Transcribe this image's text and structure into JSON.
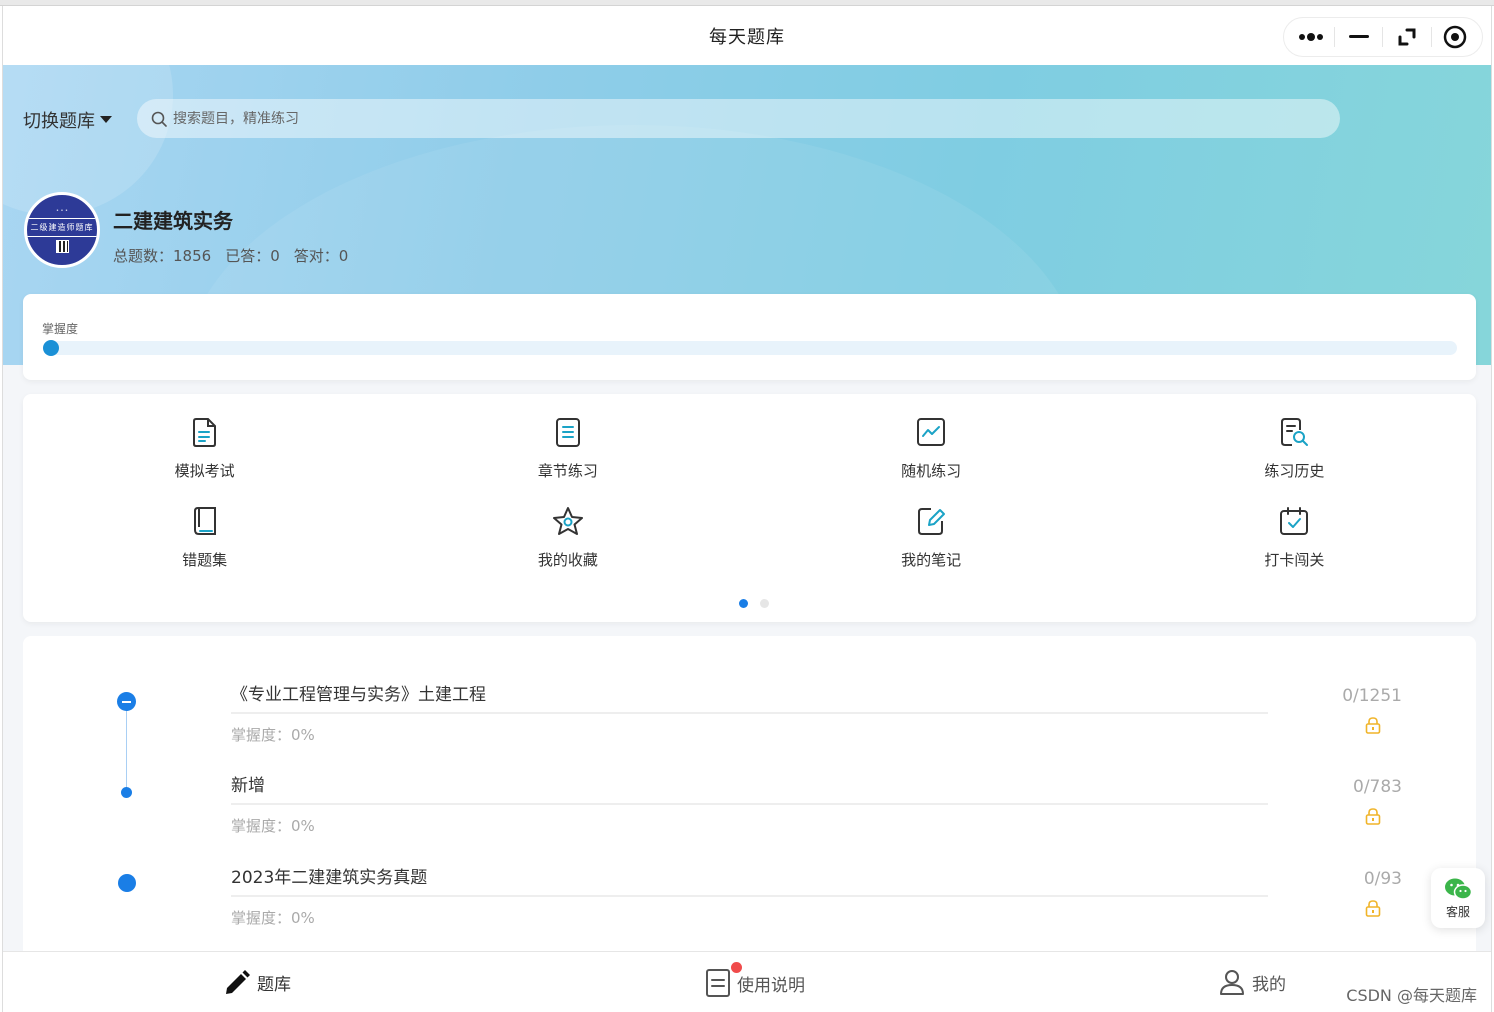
{
  "app": {
    "title": "每天题库"
  },
  "capsule": {
    "icons": [
      "more-icon",
      "minimize-icon",
      "restore-icon",
      "close-target-icon"
    ]
  },
  "header": {
    "switch_label": "切换题库",
    "search_placeholder": "搜索题目，精准练习"
  },
  "library": {
    "avatar_text": "二级建造师题库",
    "name": "二建建筑实务",
    "stats": {
      "total": "总题数：1856",
      "answered": "已答：0",
      "correct": "答对：0"
    }
  },
  "mastery": {
    "label": "掌握度",
    "progress_percent": 0
  },
  "menu": {
    "items": [
      {
        "label": "模拟考试",
        "icon": "document-icon"
      },
      {
        "label": "章节练习",
        "icon": "list-document-icon"
      },
      {
        "label": "随机练习",
        "icon": "chart-line-icon"
      },
      {
        "label": "练习历史",
        "icon": "history-search-icon"
      },
      {
        "label": "错题集",
        "icon": "book-icon"
      },
      {
        "label": "我的收藏",
        "icon": "star-icon"
      },
      {
        "label": "我的笔记",
        "icon": "note-edit-icon"
      },
      {
        "label": "打卡闯关",
        "icon": "calendar-check-icon"
      }
    ],
    "page_count": 2,
    "active_page": 1
  },
  "chapters": [
    {
      "name": "《专业工程管理与实务》土建工程",
      "mastery": "掌握度：0%",
      "count": "0/1251"
    },
    {
      "name": "新增",
      "mastery": "掌握度：0%",
      "count": "0/783"
    },
    {
      "name": "2023年二建建筑实务真题",
      "mastery": "掌握度：0%",
      "count": "0/93"
    }
  ],
  "colors": {
    "accent": "#1a7ee6",
    "lock": "#f0b429",
    "badge": "#f04b4b"
  },
  "service": {
    "label": "客服"
  },
  "tabbar": {
    "items": [
      {
        "label": "题库",
        "icon": "pencil-icon"
      },
      {
        "label": "使用说明",
        "icon": "guide-icon"
      },
      {
        "label": "我的",
        "icon": "user-icon"
      }
    ]
  },
  "watermark": "CSDN @每天题库"
}
